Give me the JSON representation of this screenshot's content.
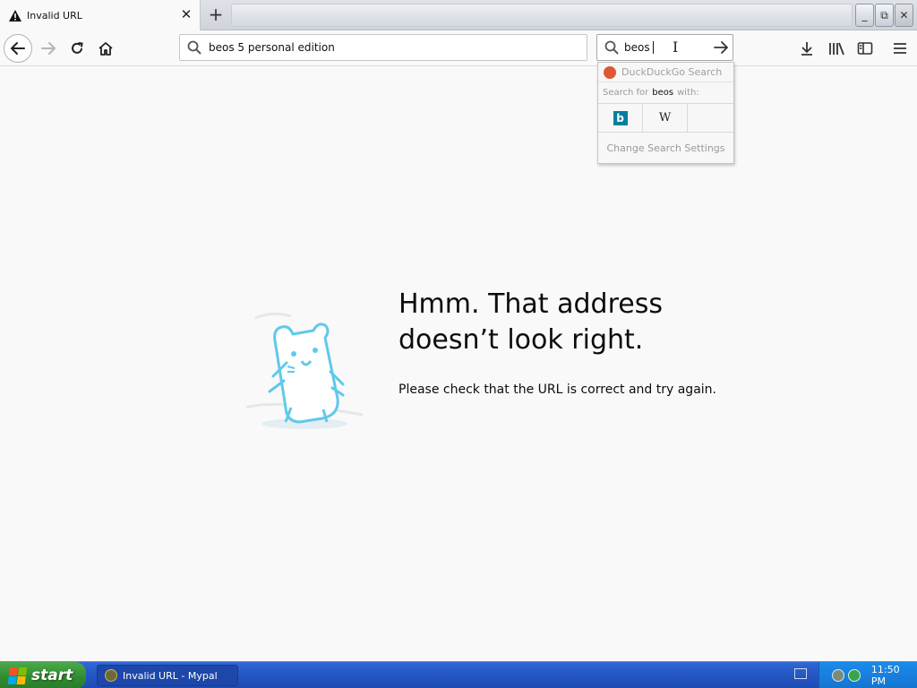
{
  "tab": {
    "title": "Invalid URL",
    "close_glyph": "✕",
    "new_tab_glyph": "+"
  },
  "window": {
    "minimize_glyph": "_",
    "restore_glyph": "⧉",
    "close_glyph": "✕"
  },
  "toolbar": {
    "url_value": "beos 5 personal edition"
  },
  "search": {
    "value": "beos"
  },
  "search_popup": {
    "engine_name": "DuckDuckGo Search",
    "search_for_prefix": "Search for",
    "search_for_term": "beos",
    "search_for_suffix": "with:",
    "engines": [
      {
        "name": "Bing",
        "glyph": "b"
      },
      {
        "name": "Wikipedia",
        "glyph": "W"
      }
    ],
    "settings_label": "Change Search Settings"
  },
  "error": {
    "title_line1": "Hmm. That address",
    "title_line2": "doesn’t look right.",
    "description": "Please check that the URL is correct and try again."
  },
  "taskbar": {
    "start_label": "start",
    "task_label": "Invalid URL - Mypal",
    "clock": "11:50 PM"
  },
  "colors": {
    "accent": "#0a84ff",
    "illustration": "#5fc9ea",
    "taskbar": "#245dd7",
    "start_button": "#3c9a3c"
  }
}
